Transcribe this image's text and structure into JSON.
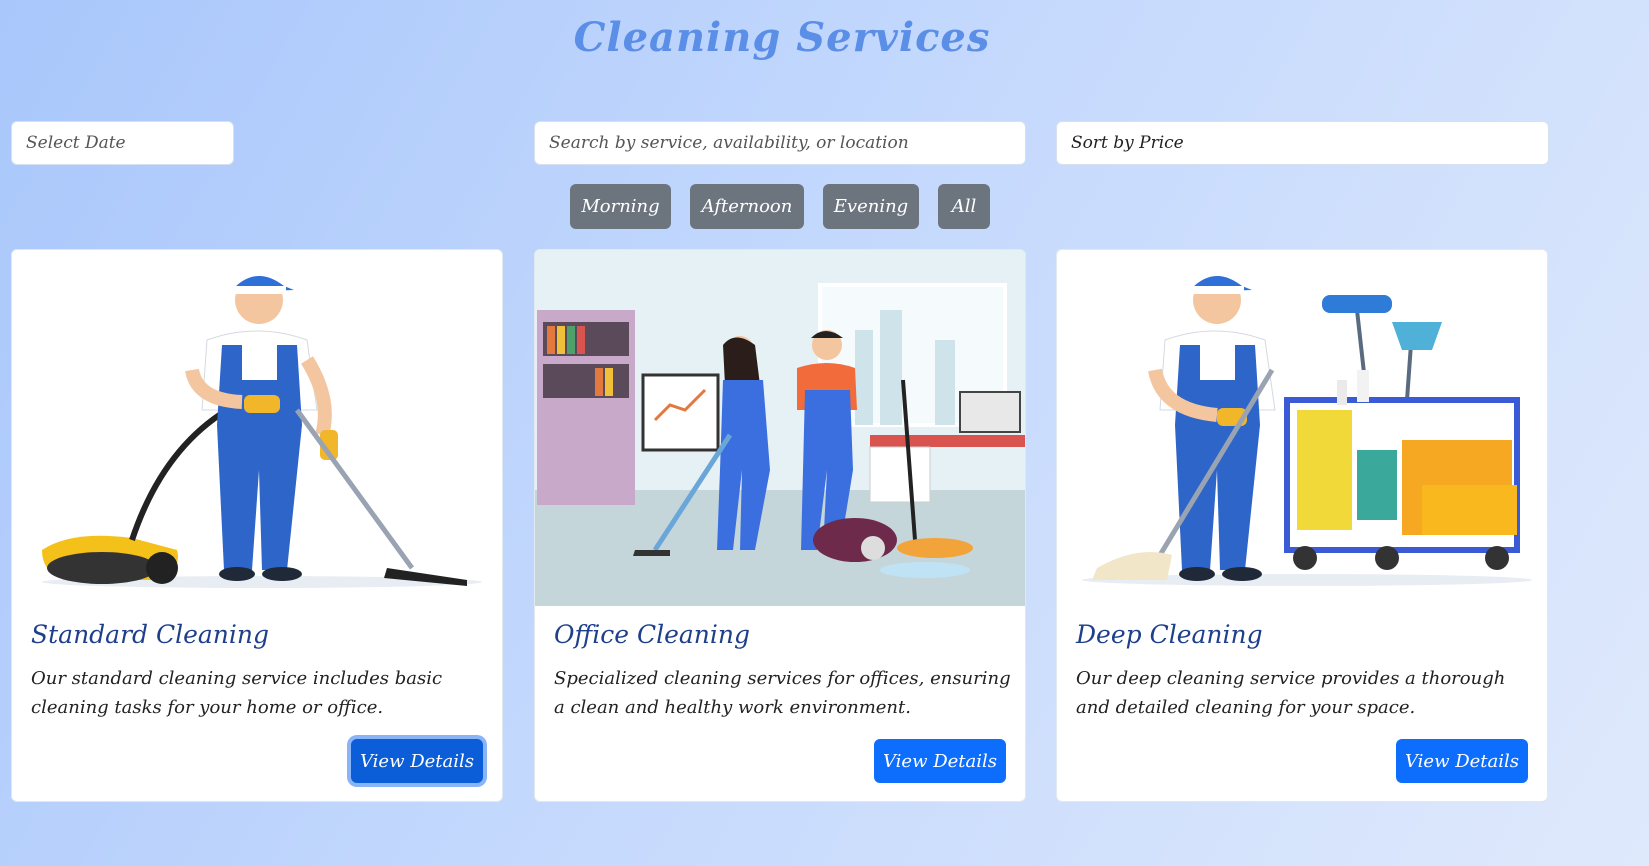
{
  "header": {
    "title": "Cleaning Services"
  },
  "filters": {
    "date_placeholder": "Select Date",
    "search_placeholder": "Search by service, availability, or location",
    "sort_value": "Sort by Price",
    "time_buttons": [
      "Morning",
      "Afternoon",
      "Evening",
      "All"
    ]
  },
  "services": [
    {
      "title": "Standard Cleaning",
      "description": "Our standard cleaning service includes basic cleaning tasks for your home or office.",
      "button_label": "View Details",
      "image": "janitor-vacuum-illustration"
    },
    {
      "title": "Office Cleaning",
      "description": "Specialized cleaning services for offices, ensuring a clean and healthy work environment.",
      "button_label": "View Details",
      "image": "office-cleaners-illustration"
    },
    {
      "title": "Deep Cleaning",
      "description": "Our deep cleaning service provides a thorough and detailed cleaning for your space.",
      "button_label": "View Details",
      "image": "janitor-mop-cart-illustration"
    }
  ],
  "colors": {
    "title": "#5b8ee6",
    "filter_button": "#6c757d",
    "primary_button": "#0d6efd",
    "card_title": "#1e3f8a"
  }
}
